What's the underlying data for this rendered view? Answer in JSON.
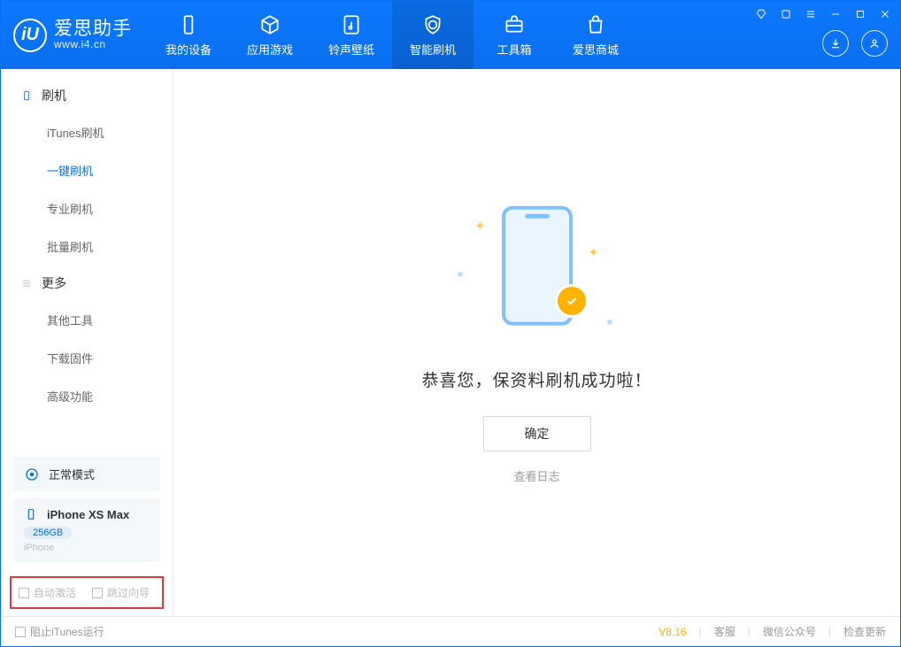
{
  "brand": {
    "title": "爱思助手",
    "subtitle": "www.i4.cn",
    "logo_letter": "iU"
  },
  "nav": {
    "items": [
      {
        "label": "我的设备",
        "icon": "device-icon"
      },
      {
        "label": "应用游戏",
        "icon": "cube-icon"
      },
      {
        "label": "铃声壁纸",
        "icon": "music-icon"
      },
      {
        "label": "智能刷机",
        "icon": "shield-icon",
        "active": true
      },
      {
        "label": "工具箱",
        "icon": "toolbox-icon"
      },
      {
        "label": "爱思商城",
        "icon": "bag-icon"
      }
    ]
  },
  "sidebar": {
    "group1": {
      "title": "刷机",
      "items": [
        "iTunes刷机",
        "一键刷机",
        "专业刷机",
        "批量刷机"
      ],
      "active_index": 1
    },
    "group2": {
      "title": "更多",
      "items": [
        "其他工具",
        "下载固件",
        "高级功能"
      ]
    },
    "mode_panel": {
      "label": "正常模式"
    },
    "device_panel": {
      "name": "iPhone XS Max",
      "capacity": "256GB",
      "type": "iPhone"
    },
    "options": {
      "auto_activate": "自动激活",
      "skip_guide": "跳过向导"
    }
  },
  "main": {
    "success_message": "恭喜您，保资料刷机成功啦！",
    "ok_button": "确定",
    "view_log": "查看日志"
  },
  "footer": {
    "block_itunes": "阻止iTunes运行",
    "version": "V8.16",
    "links": [
      "客服",
      "微信公众号",
      "检查更新"
    ]
  },
  "colors": {
    "primary": "#0a6ff0",
    "accent": "#ffb300"
  }
}
